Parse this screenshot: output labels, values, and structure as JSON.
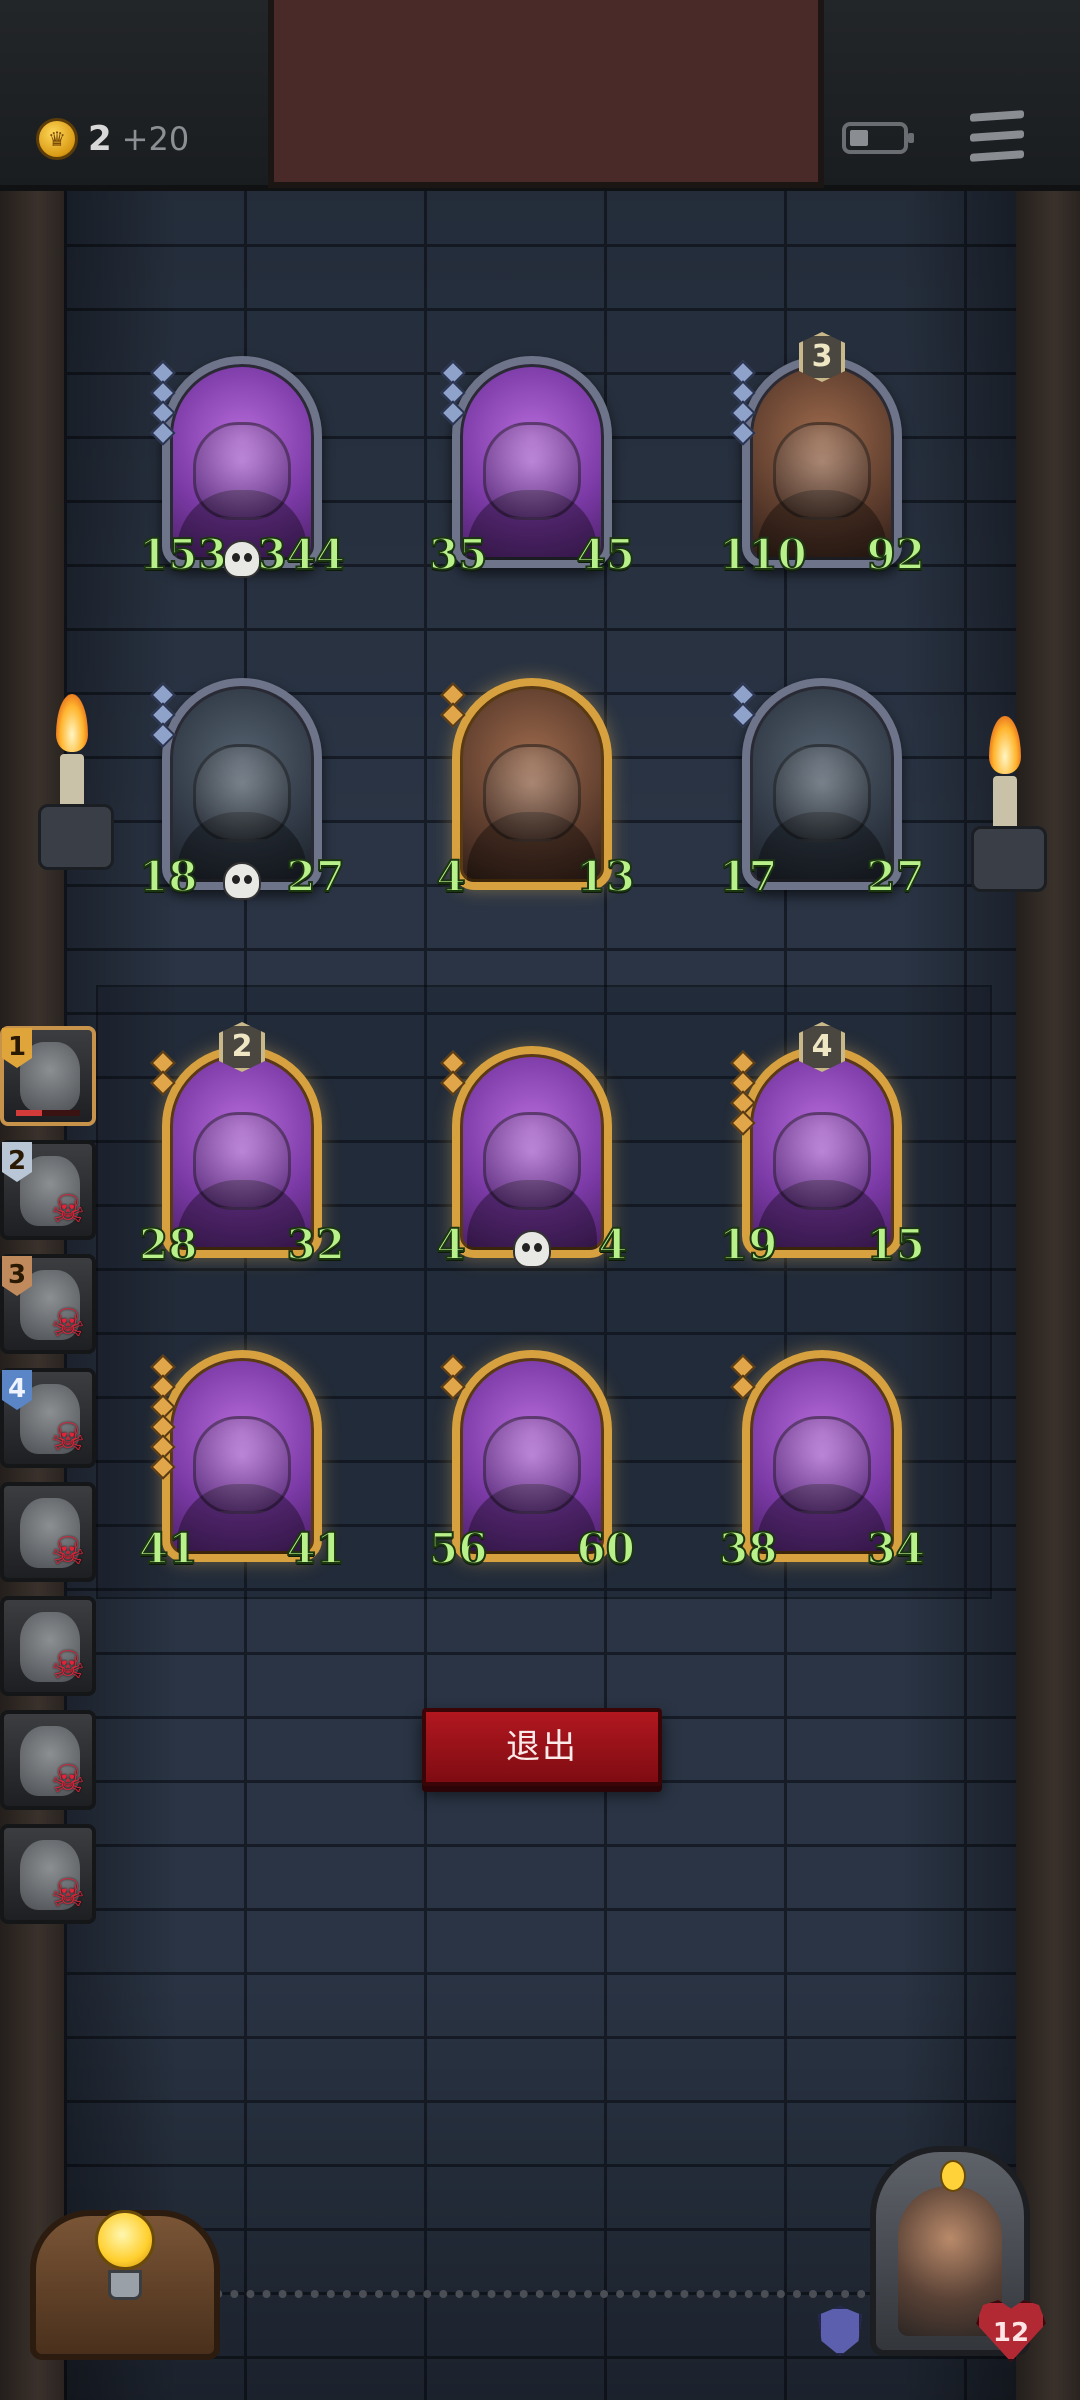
{
  "top_bar": {
    "gold": "2",
    "gold_gain": "+20"
  },
  "board": {
    "enemy_rows": [
      [
        {
          "name": "teddy-bear",
          "attack": "153",
          "health": "344",
          "frame": "silver",
          "skull": true,
          "pips": 4
        },
        {
          "name": "bee",
          "attack": "35",
          "health": "45",
          "frame": "silver",
          "pips": 3
        },
        {
          "name": "tusked-ogre",
          "attack": "110",
          "health": "92",
          "frame": "silver",
          "tier": "3",
          "pips": 4,
          "style": "brown"
        }
      ],
      [
        {
          "name": "wizard",
          "attack": "18",
          "health": "27",
          "frame": "silver",
          "skull": true,
          "pips": 3,
          "style": "dark"
        },
        {
          "name": "woodcutter",
          "attack": "4",
          "health": "13",
          "frame": "gold",
          "pips": 2,
          "style": "brown",
          "hp_style": "burst"
        },
        {
          "name": "elf-sorceress",
          "attack": "17",
          "health": "27",
          "frame": "silver",
          "pips": 2,
          "style": "dark"
        }
      ]
    ],
    "player_rows": [
      [
        {
          "name": "hooded-assassin",
          "attack": "28",
          "health": "32",
          "frame": "gold",
          "tier": "2",
          "pips": 2,
          "atk_style": "spike"
        },
        {
          "name": "pinocchio",
          "attack": "4",
          "health": "4",
          "frame": "gold",
          "skull": true,
          "pips": 2,
          "hp_style": "burst"
        },
        {
          "name": "shield-knight",
          "attack": "19",
          "health": "15",
          "frame": "gold",
          "tier": "4",
          "pips": 4
        }
      ],
      [
        {
          "name": "armored-warrior",
          "attack": "41",
          "health": "41",
          "frame": "gold",
          "pips": 6
        },
        {
          "name": "old-dwarf",
          "attack": "56",
          "health": "60",
          "frame": "gold",
          "pips": 2
        },
        {
          "name": "cross-shield",
          "attack": "38",
          "health": "34",
          "frame": "gold",
          "pips": 2
        }
      ]
    ]
  },
  "side_list": [
    {
      "rank": "1",
      "rank_style": "gold",
      "dead": false,
      "active": true
    },
    {
      "rank": "2",
      "rank_style": "silver",
      "dead": true
    },
    {
      "rank": "3",
      "rank_style": "bronze",
      "dead": true
    },
    {
      "rank": "4",
      "rank_style": "blue",
      "dead": true
    },
    {
      "rank": "",
      "dead": true
    },
    {
      "rank": "",
      "dead": true
    },
    {
      "rank": "",
      "dead": true
    },
    {
      "rank": "",
      "dead": true
    }
  ],
  "exit_button": {
    "label": "退出"
  },
  "hero": {
    "health": "12"
  },
  "icons": {
    "coin": "crown-coin-icon",
    "battery": "battery-icon",
    "menu": "hamburger-menu-icon",
    "dead": "skull-crossbones-icon",
    "hint": "light-bulb-icon",
    "armor": "shield-icon",
    "health": "heart-icon"
  }
}
